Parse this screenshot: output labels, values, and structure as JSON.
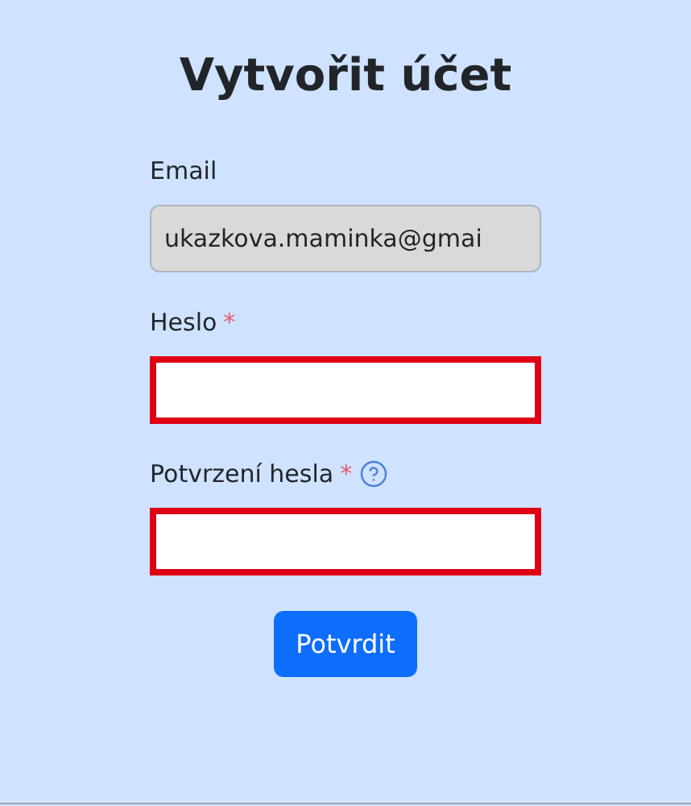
{
  "title": "Vytvořit účet",
  "fields": [
    {
      "label": "Email",
      "value": "ukazkova.maminka@gmai",
      "required": false,
      "disabled": true,
      "invalid": false,
      "help": false
    },
    {
      "label": "Heslo",
      "required": true,
      "disabled": false,
      "invalid": true,
      "help": false
    },
    {
      "label": "Potvrzení hesla",
      "required": true,
      "disabled": false,
      "invalid": true,
      "help": true
    }
  ],
  "required_mark": "*",
  "submit": {
    "label": "Potvrdit"
  }
}
